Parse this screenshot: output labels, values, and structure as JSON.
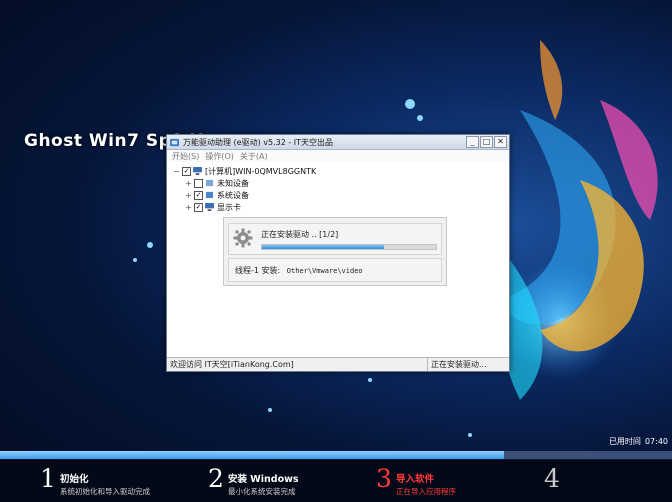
{
  "background": {
    "headline": "Ghost Win7 Sp1 X",
    "colors": {
      "accent": "#2d8fe0",
      "active_step": "#ff3a3a"
    }
  },
  "window": {
    "title": "万能驱动助理 (e驱动) v5.32 - IT天空出品",
    "buttons": {
      "minimize": "_",
      "maximize": "□",
      "close": "✕"
    },
    "menu": [
      "开始(S)",
      "操作(O)",
      "关于(A)"
    ],
    "tree": {
      "root": "[计算机]WIN-0QMVL8GGNTK",
      "children": [
        {
          "label": "未知设备",
          "checked": false
        },
        {
          "label": "系统设备",
          "checked": true
        },
        {
          "label": "显示卡",
          "checked": true
        }
      ]
    },
    "progress": {
      "status": "正在安装驱动 ..  [1/2]",
      "fraction": 0.7,
      "thread_label": "线程-1 安装:",
      "thread_path": "Other\\Vmware\\video"
    },
    "statusbar": {
      "left": "欢迎访问 IT天空[iTianKong.Com]",
      "right": "正在安装驱动..."
    }
  },
  "overall": {
    "fraction": 0.75,
    "elapsed_label": "已用时间",
    "elapsed_value": "07:40"
  },
  "steps": [
    {
      "num": "1",
      "label": "初始化",
      "sub": "系统初始化和导入驱动完成"
    },
    {
      "num": "2",
      "label": "安装 Windows",
      "sub": "最小化系统安装完成"
    },
    {
      "num": "3",
      "label": "导入软件",
      "sub": "正在导入应用程序"
    },
    {
      "num": "4",
      "label": "",
      "sub": ""
    }
  ]
}
